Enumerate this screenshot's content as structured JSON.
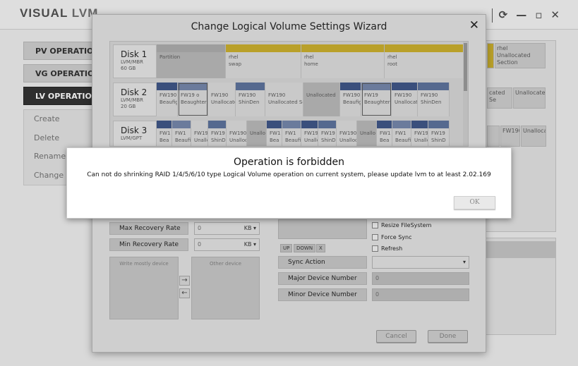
{
  "app": {
    "logo_visual": "VISUAL",
    "logo_lvm": "LVM"
  },
  "window_controls": {
    "refresh": "⟳",
    "minimize": "—",
    "maximize": "▫",
    "close": "✕"
  },
  "sidebar": {
    "pv_operation": "PV OPERATION",
    "vg_operation": "VG OPERATION",
    "lv_operation": "LV OPERATION",
    "lv_items": [
      "Create",
      "Delete",
      "Rename",
      "Change"
    ]
  },
  "right_panel": {
    "cells": [
      "rhel",
      "Unallocated Section",
      "Unallocated",
      "cated Se",
      "FW1901",
      "Unallocated",
      "Unallocat"
    ]
  },
  "wizard": {
    "title": "Change Logical Volume Settings Wizard",
    "close": "✕",
    "disks": [
      {
        "name": "Disk 1",
        "type": "LVM/MBR",
        "size": "60 GB",
        "partitions": [
          {
            "label1": "Partition",
            "label2": "",
            "color": "#9e9e9e",
            "grey": true
          },
          {
            "label1": "rhel",
            "label2": "swap",
            "color": "#b9a02a"
          },
          {
            "label1": "rhel",
            "label2": "home",
            "color": "#b9a02a"
          },
          {
            "label1": "rhel",
            "label2": "root",
            "color": "#b9a02a"
          }
        ]
      },
      {
        "name": "Disk 2",
        "type": "LVM/MBR",
        "size": "20 GB",
        "partitions": [
          {
            "label1": "FW190",
            "label2": "Beaufig",
            "color": "#3a4f7c"
          },
          {
            "label1": "FW19 o",
            "label2": "Beaughter",
            "color": "#6b7b9c",
            "sel": true
          },
          {
            "label1": "FW190",
            "label2": "Unallocate",
            "color": "#c9c9c9"
          },
          {
            "label1": "FW190",
            "label2": "ShinDen",
            "color": "#55698f"
          },
          {
            "label1": "FW190",
            "label2": "Unallocated Sec",
            "color": "#c9c9c9"
          },
          {
            "label1": "Unallocated",
            "label2": "",
            "color": "#a9a9a9",
            "grey": true
          },
          {
            "label1": "FW190",
            "label2": "Beaufig",
            "color": "#3a4f7c"
          },
          {
            "label1": "FW19",
            "label2": "Beaughter",
            "color": "#6b7b9c",
            "sel": true
          },
          {
            "label1": "FW190",
            "label2": "Unallocate",
            "color": "#3a4f7c"
          },
          {
            "label1": "FW190",
            "label2": "ShinDen",
            "color": "#55698f"
          }
        ]
      },
      {
        "name": "Disk 3",
        "type": "LVM/GPT",
        "size": "",
        "partitions": [
          {
            "label1": "FW1",
            "label2": "Bea",
            "color": "#3a4f7c"
          },
          {
            "label1": "FW1",
            "label2": "Beaufi",
            "color": "#6b7b9c"
          },
          {
            "label1": "FW19",
            "label2": "Unallc",
            "color": "#c9c9c9"
          },
          {
            "label1": "FW19",
            "label2": "ShinD",
            "color": "#55698f"
          },
          {
            "label1": "FW190",
            "label2": "Unalloca",
            "color": "#c9c9c9"
          },
          {
            "label1": "Unallo",
            "label2": "",
            "color": "#a9a9a9",
            "grey": true
          },
          {
            "label1": "FW1",
            "label2": "Bea",
            "color": "#3a4f7c"
          },
          {
            "label1": "FW1",
            "label2": "Beaufi",
            "color": "#6b7b9c"
          },
          {
            "label1": "FW19",
            "label2": "Unallc",
            "color": "#3a4f7c"
          },
          {
            "label1": "FW19",
            "label2": "ShinD",
            "color": "#55698f"
          },
          {
            "label1": "FW190",
            "label2": "Unalloc",
            "color": "#c9c9c9"
          },
          {
            "label1": "Unallo",
            "label2": "",
            "color": "#a9a9a9",
            "grey": true
          },
          {
            "label1": "FW1",
            "label2": "Bea",
            "color": "#3a4f7c"
          },
          {
            "label1": "FW1",
            "label2": "Beaufi",
            "color": "#6b7b9c"
          },
          {
            "label1": "FW19",
            "label2": "Unallc",
            "color": "#3a4f7c"
          },
          {
            "label1": "FW19",
            "label2": "ShinD",
            "color": "#55698f"
          }
        ]
      }
    ],
    "max_recovery_label": "Max Recovery Rate",
    "max_recovery_value": "0",
    "max_recovery_unit": "KB ▾",
    "min_recovery_label": "Min Recovery Rate",
    "min_recovery_value": "0",
    "min_recovery_unit": "KB ▾",
    "write_mostly_label": "Write mostly device",
    "other_device_label": "Other device",
    "move_right": "→",
    "move_left": "←",
    "up": "UP",
    "down": "DOWN",
    "remove": "X",
    "resize_fs": "Resize FileSystem",
    "force_sync": "Force Sync",
    "refresh": "Refresh",
    "sync_action_label": "Sync Action",
    "sync_action_value": "",
    "sync_action_arrow": "▾",
    "major_label": "Major Device Number",
    "major_value": "0",
    "minor_label": "Minor Device Number",
    "minor_value": "0",
    "cancel": "Cancel",
    "done": "Done"
  },
  "modal": {
    "title": "Operation is forbidden",
    "message": "Can not do shrinking RAID 1/4/5/6/10 type Logical Volume operation on current system, please update lvm to at least 2.02.169",
    "ok": "OK"
  }
}
